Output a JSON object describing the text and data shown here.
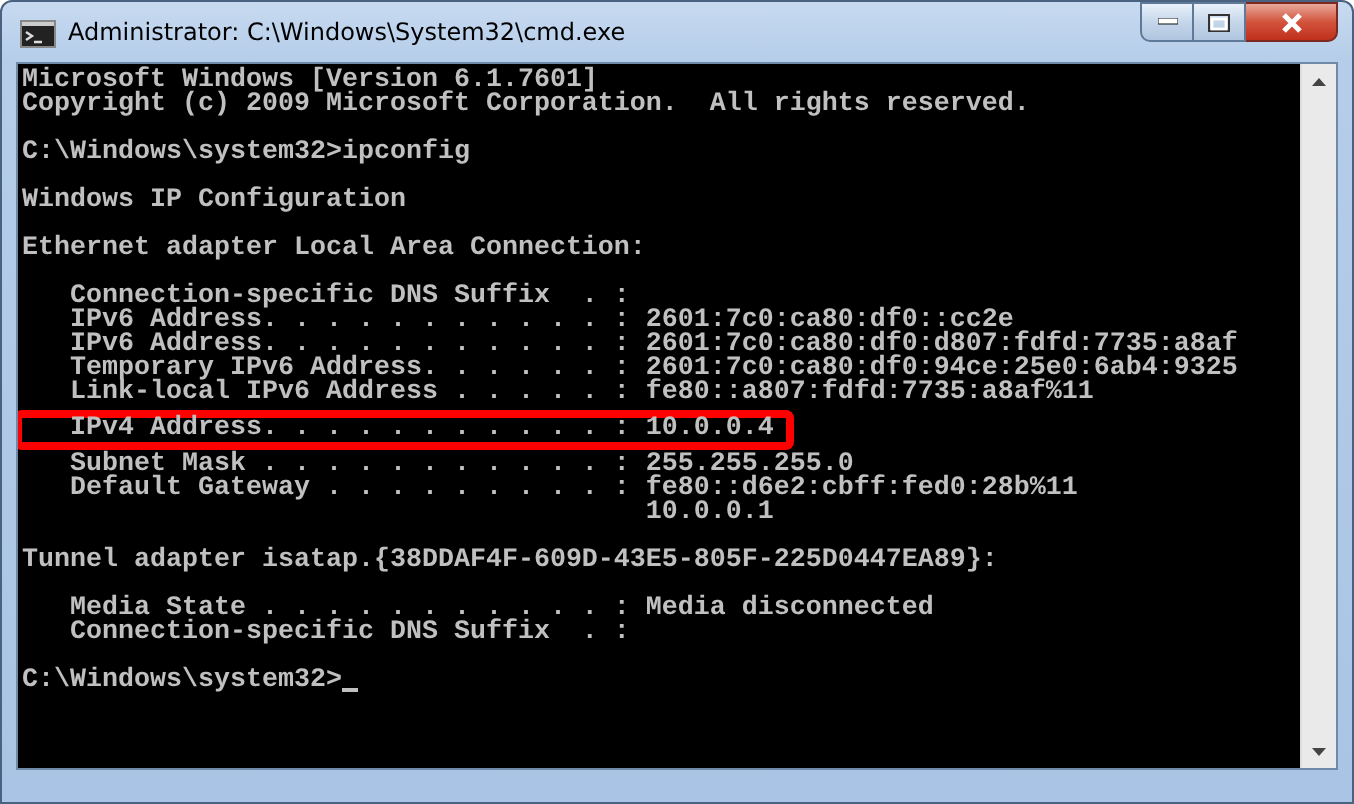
{
  "window": {
    "title": "Administrator: C:\\Windows\\System32\\cmd.exe"
  },
  "console": {
    "lines": [
      {
        "kind": "text",
        "text": "Microsoft Windows [Version 6.1.7601]",
        "highlighted": false
      },
      {
        "kind": "text",
        "text": "Copyright (c) 2009 Microsoft Corporation.  All rights reserved.",
        "highlighted": false
      },
      {
        "kind": "blank"
      },
      {
        "kind": "text",
        "text": "C:\\Windows\\system32>ipconfig",
        "highlighted": false
      },
      {
        "kind": "blank"
      },
      {
        "kind": "text",
        "text": "Windows IP Configuration",
        "highlighted": false
      },
      {
        "kind": "blank"
      },
      {
        "kind": "text",
        "text": "Ethernet adapter Local Area Connection:",
        "highlighted": false
      },
      {
        "kind": "blank"
      },
      {
        "kind": "text",
        "text": "   Connection-specific DNS Suffix  . :",
        "highlighted": false
      },
      {
        "kind": "text",
        "text": "   IPv6 Address. . . . . . . . . . . : 2601:7c0:ca80:df0::cc2e",
        "highlighted": false
      },
      {
        "kind": "text",
        "text": "   IPv6 Address. . . . . . . . . . . : 2601:7c0:ca80:df0:d807:fdfd:7735:a8af",
        "highlighted": false
      },
      {
        "kind": "text",
        "text": "   Temporary IPv6 Address. . . . . . : 2601:7c0:ca80:df0:94ce:25e0:6ab4:9325",
        "highlighted": false
      },
      {
        "kind": "text",
        "text": "   Link-local IPv6 Address . . . . . : fe80::a807:fdfd:7735:a8af%11",
        "highlighted": false
      },
      {
        "kind": "text",
        "text": "   IPv4 Address. . . . . . . . . . . : 10.0.0.4",
        "highlighted": true
      },
      {
        "kind": "text",
        "text": "   Subnet Mask . . . . . . . . . . . : 255.255.255.0",
        "highlighted": false
      },
      {
        "kind": "text",
        "text": "   Default Gateway . . . . . . . . . : fe80::d6e2:cbff:fed0:28b%11",
        "highlighted": false
      },
      {
        "kind": "text",
        "text": "                                       10.0.0.1",
        "highlighted": false
      },
      {
        "kind": "blank"
      },
      {
        "kind": "text",
        "text": "Tunnel adapter isatap.{38DDAF4F-609D-43E5-805F-225D0447EA89}:",
        "highlighted": false
      },
      {
        "kind": "blank"
      },
      {
        "kind": "text",
        "text": "   Media State . . . . . . . . . . . : Media disconnected",
        "highlighted": false
      },
      {
        "kind": "text",
        "text": "   Connection-specific DNS Suffix  . :",
        "highlighted": false
      },
      {
        "kind": "blank"
      },
      {
        "kind": "prompt",
        "text": "C:\\Windows\\system32>"
      }
    ]
  }
}
